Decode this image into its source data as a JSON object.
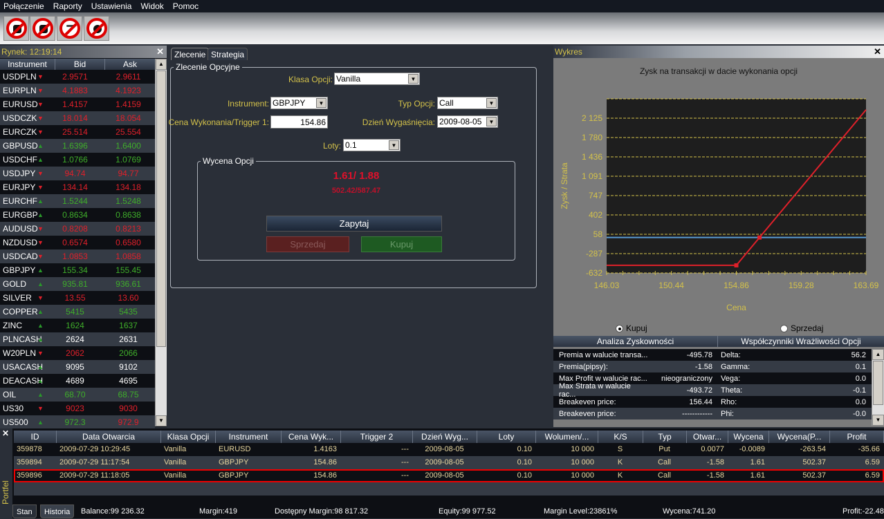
{
  "menu": [
    "Połączenie",
    "Raporty",
    "Ustawienia",
    "Widok",
    "Pomoc"
  ],
  "toolbar": {
    "icons": [
      "disconnect-icon",
      "plug-icon",
      "edit-note-icon",
      "settings-gears-icon"
    ]
  },
  "market": {
    "title": "Rynek: 12:19:14",
    "columns": [
      "Instrument",
      "Bid",
      "Ask"
    ],
    "colors": {
      "red": "#e0202a",
      "green": "#3fae2a",
      "white": "#ffffff"
    },
    "rows": [
      {
        "name": "USDPLN",
        "dir": "down",
        "bid": "2.9571",
        "ask": "2.9611",
        "bid_color": "red",
        "ask_color": "red"
      },
      {
        "name": "EURPLN",
        "dir": "down",
        "bid": "4.1883",
        "ask": "4.1923",
        "bid_color": "red",
        "ask_color": "red"
      },
      {
        "name": "EURUSD",
        "dir": "down",
        "bid": "1.4157",
        "ask": "1.4159",
        "bid_color": "red",
        "ask_color": "red"
      },
      {
        "name": "USDCZK",
        "dir": "down",
        "bid": "18.014",
        "ask": "18.054",
        "bid_color": "red",
        "ask_color": "red"
      },
      {
        "name": "EURCZK",
        "dir": "down",
        "bid": "25.514",
        "ask": "25.554",
        "bid_color": "red",
        "ask_color": "red"
      },
      {
        "name": "GBPUSD",
        "dir": "up",
        "bid": "1.6396",
        "ask": "1.6400",
        "bid_color": "green",
        "ask_color": "green"
      },
      {
        "name": "USDCHF",
        "dir": "up",
        "bid": "1.0766",
        "ask": "1.0769",
        "bid_color": "green",
        "ask_color": "green"
      },
      {
        "name": "USDJPY",
        "dir": "down",
        "bid": "94.74",
        "ask": "94.77",
        "bid_color": "red",
        "ask_color": "red"
      },
      {
        "name": "EURJPY",
        "dir": "down",
        "bid": "134.14",
        "ask": "134.18",
        "bid_color": "red",
        "ask_color": "red"
      },
      {
        "name": "EURCHF",
        "dir": "up",
        "bid": "1.5244",
        "ask": "1.5248",
        "bid_color": "green",
        "ask_color": "green"
      },
      {
        "name": "EURGBP",
        "dir": "up",
        "bid": "0.8634",
        "ask": "0.8638",
        "bid_color": "green",
        "ask_color": "green"
      },
      {
        "name": "AUDUSD",
        "dir": "down",
        "bid": "0.8208",
        "ask": "0.8213",
        "bid_color": "red",
        "ask_color": "red"
      },
      {
        "name": "NZDUSD",
        "dir": "down",
        "bid": "0.6574",
        "ask": "0.6580",
        "bid_color": "red",
        "ask_color": "red"
      },
      {
        "name": "USDCAD",
        "dir": "down",
        "bid": "1.0853",
        "ask": "1.0858",
        "bid_color": "red",
        "ask_color": "red"
      },
      {
        "name": "GBPJPY",
        "dir": "up",
        "bid": "155.34",
        "ask": "155.45",
        "bid_color": "green",
        "ask_color": "green"
      },
      {
        "name": "GOLD",
        "dir": "up",
        "bid": "935.81",
        "ask": "936.61",
        "bid_color": "green",
        "ask_color": "green"
      },
      {
        "name": "SILVER",
        "dir": "down",
        "bid": "13.55",
        "ask": "13.60",
        "bid_color": "red",
        "ask_color": "red"
      },
      {
        "name": "COPPER",
        "dir": "up",
        "bid": "5415",
        "ask": "5435",
        "bid_color": "green",
        "ask_color": "green"
      },
      {
        "name": "ZINC",
        "dir": "up",
        "bid": "1624",
        "ask": "1637",
        "bid_color": "green",
        "ask_color": "green"
      },
      {
        "name": "PLNCASH",
        "dir": "up",
        "bid": "2624",
        "ask": "2631",
        "bid_color": "white",
        "ask_color": "white"
      },
      {
        "name": "W20PLN",
        "dir": "down",
        "bid": "2062",
        "ask": "2066",
        "bid_color": "red",
        "ask_color": "green"
      },
      {
        "name": "USACASH",
        "dir": "up",
        "bid": "9095",
        "ask": "9102",
        "bid_color": "white",
        "ask_color": "white"
      },
      {
        "name": "DEACASH",
        "dir": "up",
        "bid": "4689",
        "ask": "4695",
        "bid_color": "white",
        "ask_color": "white"
      },
      {
        "name": "OIL",
        "dir": "up",
        "bid": "68.70",
        "ask": "68.75",
        "bid_color": "green",
        "ask_color": "green"
      },
      {
        "name": "US30",
        "dir": "down",
        "bid": "9023",
        "ask": "9030",
        "bid_color": "red",
        "ask_color": "red"
      },
      {
        "name": "US500",
        "dir": "up",
        "bid": "972.3",
        "ask": "972.9",
        "bid_color": "green",
        "ask_color": "red"
      }
    ]
  },
  "order": {
    "tabs": [
      "Zlecenie",
      "Strategia"
    ],
    "group_title": "Zlecenie Opcyjne",
    "klasa_label": "Klasa Opcji:",
    "klasa_value": "Vanilla",
    "instrument_label": "Instrument:",
    "instrument_value": "GBPJPY",
    "typ_label": "Typ Opcji:",
    "typ_value": "Call",
    "cena_label": "Cena Wykonania/Trigger 1:",
    "cena_value": "154.86",
    "dzien_label": "Dzień Wygaśnięcia:",
    "dzien_value": "2009-08-05",
    "loty_label": "Loty:",
    "loty_value": "0.1",
    "wycena_title": "Wycena Opcji",
    "quote_main": "1.61/ 1.88",
    "quote_sub": "502.42/587.47",
    "ask_button": "Zapytaj",
    "sell_button": "Sprzedaj",
    "buy_button": "Kupuj"
  },
  "chart_panel": {
    "title": "Wykres",
    "buy_radio": "Kupuj",
    "sell_radio": "Sprzedaj",
    "selected": "Kupuj"
  },
  "chart_data": {
    "type": "line",
    "title": "Zysk na transakcji w dacie wykonania opcji",
    "xlabel": "Cena",
    "ylabel": "Zysk / Strata",
    "xlim": [
      146.03,
      163.69
    ],
    "ylim": [
      -632,
      2470
    ],
    "x_ticks": [
      "146.03",
      "150.44",
      "154.86",
      "159.28",
      "163.69"
    ],
    "y_ticks": [
      "2 125",
      "1 780",
      "1 436",
      "1 091",
      "747",
      "402",
      "58",
      "-287",
      "-632"
    ],
    "y_tick_values": [
      2125,
      1780,
      1436,
      1091,
      747,
      402,
      58,
      -287,
      -632
    ],
    "grid": true,
    "series": [
      {
        "x": [
          146.03,
          154.86,
          156.44,
          163.69
        ],
        "y": [
          -495.78,
          -495.78,
          0,
          2275
        ],
        "color": "#e0202a",
        "markers": [
          1,
          2
        ]
      }
    ],
    "zero_line": {
      "y": 0,
      "color": "#5b9bd5"
    }
  },
  "analysis": {
    "head_left": "Analiza Zyskowności",
    "head_right": "Współczynniki Wrażliwości Opcji",
    "rows": [
      {
        "label": "Premia w walucie transa...",
        "value": "-495.78",
        "greek": "Delta:",
        "gval": "56.2"
      },
      {
        "label": "Premia(pipsy):",
        "value": "-1.58",
        "greek": "Gamma:",
        "gval": "0.1"
      },
      {
        "label": "Max Profit w walucie rac...",
        "value": "nieograniczony",
        "greek": "Vega:",
        "gval": "0.0"
      },
      {
        "label": "Max Strata w walucie rac...",
        "value": "-493.72",
        "greek": "Theta:",
        "gval": "-0.1"
      },
      {
        "label": "Breakeven price:",
        "value": "156.44",
        "greek": "Rho:",
        "gval": "0.0"
      },
      {
        "label": "Breakeven price:",
        "value": "------------",
        "greek": "Phi:",
        "gval": "-0.0"
      }
    ]
  },
  "portfolio": {
    "side_label": "Portfel",
    "columns": [
      "ID",
      "Data Otwarcia",
      "Klasa Opcji",
      "Instrument",
      "Cena Wyk...",
      "Trigger 2",
      "Dzień Wyg...",
      "Loty",
      "Wolumen/...",
      "K/S",
      "Typ",
      "Otwar...",
      "Wycena",
      "Wycena(P...",
      "Profit"
    ],
    "rows": [
      [
        "359878",
        "2009-07-29 10:29:45",
        "Vanilla",
        "EURUSD",
        "1.4163",
        "---",
        "2009-08-05",
        "0.10",
        "10 000",
        "S",
        "Put",
        "0.0077",
        "-0.0089",
        "-263.54",
        "-35.66"
      ],
      [
        "359894",
        "2009-07-29 11:17:54",
        "Vanilla",
        "GBPJPY",
        "154.86",
        "---",
        "2009-08-05",
        "0.10",
        "10 000",
        "K",
        "Call",
        "-1.58",
        "1.61",
        "502.37",
        "6.59"
      ],
      [
        "359896",
        "2009-07-29 11:18:05",
        "Vanilla",
        "GBPJPY",
        "154.86",
        "---",
        "2009-08-05",
        "0.10",
        "10 000",
        "K",
        "Call",
        "-1.58",
        "1.61",
        "502.37",
        "6.59"
      ]
    ],
    "selected_row": 2,
    "tabs": [
      "Stan",
      "Historia"
    ],
    "status": {
      "balance": "Balance:99 236.32",
      "margin": "Margin:419",
      "free_margin": "Dostępny Margin:98 817.32",
      "equity": "Equity:99 977.52",
      "margin_level": "Margin Level:23861%",
      "wycena": "Wycena:741.20",
      "profit": "Profit:-22.48"
    }
  }
}
